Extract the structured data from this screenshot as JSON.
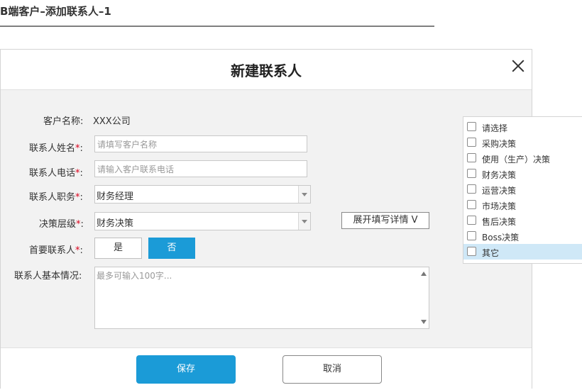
{
  "page": {
    "title": "B端客户–添加联系人–1"
  },
  "dialog": {
    "title": "新建联系人",
    "customer_name": {
      "label": "客户名称:",
      "value": "XXX公司"
    },
    "contact_name": {
      "label": "联系人姓名",
      "suffix": ":",
      "placeholder": "请填写客户名称"
    },
    "contact_phone": {
      "label": "联系人电话",
      "suffix": ":",
      "placeholder": "请输入客户联系电话"
    },
    "contact_position": {
      "label": "联系人职务",
      "suffix": ":",
      "selected": "财务经理"
    },
    "decision_level": {
      "label": "决策层级",
      "suffix": ":",
      "selected": "财务决策"
    },
    "expand_button": "展开填写详情 V",
    "primary_contact": {
      "label": "首要联系人",
      "suffix": ":",
      "yes": "是",
      "no": "否"
    },
    "basic_info": {
      "label": "联系人基本情况:",
      "placeholder": "最多可输入100字..."
    },
    "required_mark": "*",
    "save_label": "保存",
    "cancel_label": "取消"
  },
  "decision_dropdown": {
    "options": [
      "请选择",
      "采购决策",
      "使用（生产）决策",
      "财务决策",
      "运营决策",
      "市场决策",
      "售后决策",
      "Boss决策",
      "其它"
    ],
    "highlighted_index": 8
  },
  "colors": {
    "primary": "#1b9bd7",
    "required": "#d9001b",
    "highlight": "#cfe8f7"
  }
}
